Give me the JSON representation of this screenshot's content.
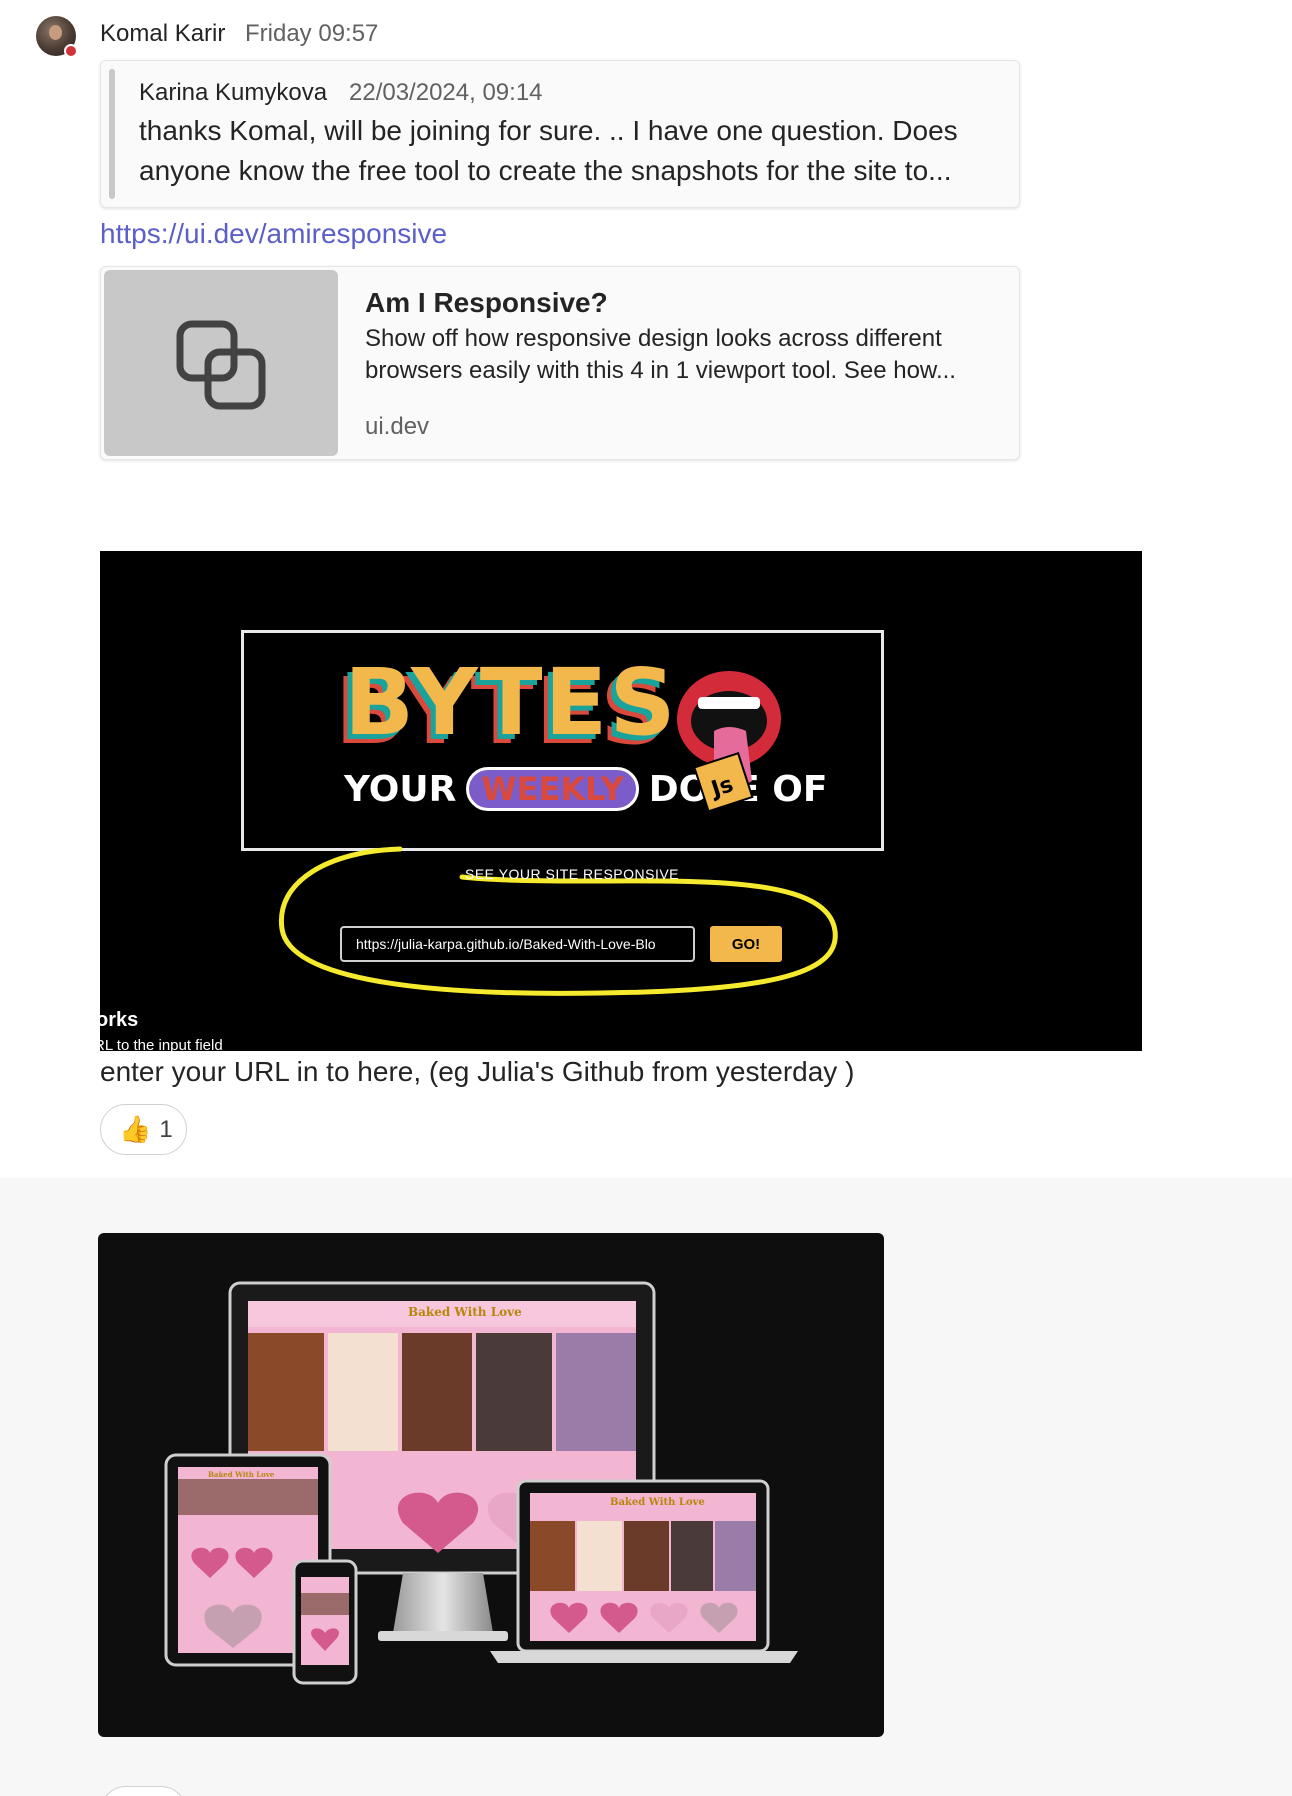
{
  "message": {
    "sender": "Komal Karir",
    "time": "Friday 09:57",
    "quote": {
      "author": "Karina Kumykova",
      "date": "22/03/2024, 09:14",
      "text": "thanks Komal, will be joining for sure. .. I have one question. Does anyone know the free tool to create the snapshots for the site to..."
    },
    "link": "https://ui.dev/amiresponsive",
    "preview": {
      "title": "Am I Responsive?",
      "description": "Show off how responsive design looks across different browsers easily with this 4 in 1 viewport tool. See how...",
      "domain": "ui.dev"
    },
    "screenshot": {
      "bytes_logo_text": "BYTES",
      "your": "YOUR",
      "weekly": "WEEKLY",
      "dose_of": "DOSE OF",
      "js": "Js",
      "see_label": "SEE YOUR SITE RESPONSIVE",
      "url_value": "https://julia-karpa.github.io/Baked-With-Love-Blo",
      "go_label": "GO!",
      "works_text": "orks",
      "hint_text": "RL to the input field"
    },
    "caption": "enter your URL in to here, (eg Julia's Github from yesterday )",
    "reaction": {
      "emoji": "👍",
      "count": "1"
    }
  },
  "message2": {
    "screenshot": {
      "site_title": "Baked With Love"
    }
  }
}
